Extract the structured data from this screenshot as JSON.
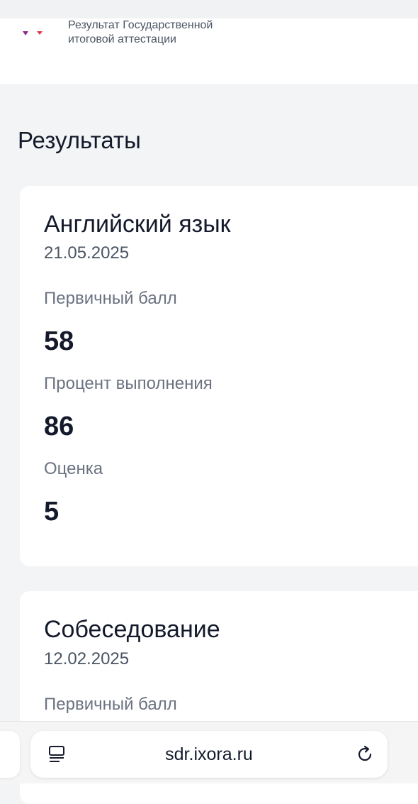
{
  "header": {
    "title": "Результат Государственной\nитоговой аттестации"
  },
  "page": {
    "title": "Результаты"
  },
  "results": [
    {
      "subject": "Английский язык",
      "date": "21.05.2025",
      "primary_score_label": "Первичный балл",
      "primary_score": "58",
      "percent_label": "Процент выполнения",
      "percent": "86",
      "grade_label": "Оценка",
      "grade": "5"
    },
    {
      "subject": "Собеседование",
      "date": "12.02.2025",
      "primary_score_label": "Первичный балл"
    }
  ],
  "browser": {
    "url": "sdr.ixora.ru",
    "icons": [
      "reader-icon",
      "reload-icon"
    ]
  },
  "colors": {
    "logo_purple": "#8e2a8a",
    "logo_red": "#e0334b",
    "background": "#f3f4f6",
    "text": "#141a2b"
  }
}
